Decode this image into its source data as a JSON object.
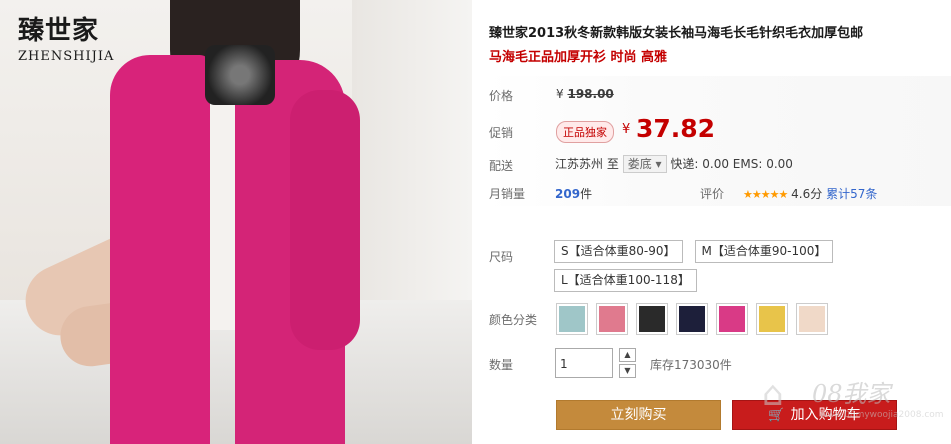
{
  "brand": {
    "name_cn": "臻世家",
    "name_en": "ZHENSHIJIA"
  },
  "product": {
    "title": "臻世家2013秋冬新款韩版女装长袖马海毛长毛针织毛衣加厚包邮",
    "subtitle": "马海毛正品加厚开衫 时尚 高雅"
  },
  "price": {
    "label": "价格",
    "currency": "¥",
    "original": "198.00"
  },
  "promo": {
    "label": "促销",
    "badge": "正品独家",
    "currency": "¥",
    "value": "37.82"
  },
  "shipping": {
    "label": "配送",
    "from": "江苏苏州",
    "to_word": "至",
    "destination": "娄底",
    "fees": "快递: 0.00 EMS: 0.00"
  },
  "sales": {
    "label": "月销量",
    "count": "209",
    "unit": "件",
    "rating_label": "评价",
    "stars": "★★★★★",
    "score": "4.6分",
    "reviews": "累计57条"
  },
  "size": {
    "label": "尺码",
    "options": [
      "S【适合体重80-90】",
      "M【适合体重90-100】",
      "L【适合体重100-118】"
    ]
  },
  "color": {
    "label": "颜色分类",
    "swatches": [
      "#9fc6c8",
      "#e07a8e",
      "#2a2a2a",
      "#1d1f3a",
      "#d93a86",
      "#e8c44a",
      "#f0d9c8"
    ]
  },
  "quantity": {
    "label": "数量",
    "value": "1",
    "stock": "库存173030件"
  },
  "actions": {
    "buy_now": "立刻购买",
    "add_to_cart": "加入购物车"
  },
  "watermark": {
    "text": "08我家",
    "url": "www.08mywoojia2008.com"
  }
}
